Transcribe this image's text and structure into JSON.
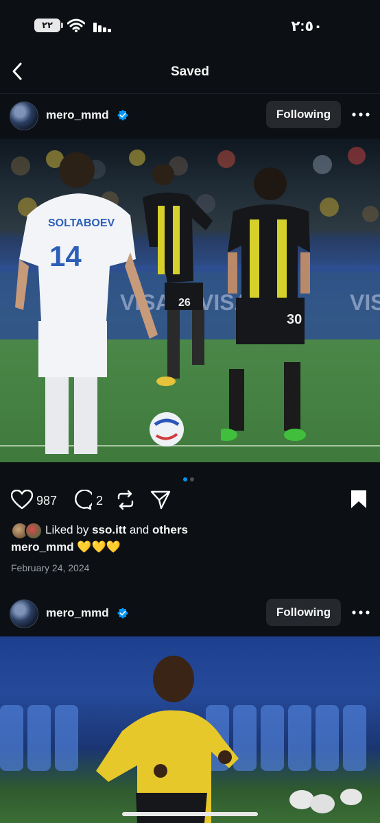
{
  "status_bar": {
    "time": "٢:٥٠",
    "battery": "٢٢"
  },
  "nav": {
    "title": "Saved"
  },
  "posts": [
    {
      "username": "mero_mmd",
      "follow_label": "Following",
      "likes": "987",
      "comments": "2",
      "liked_by_prefix": "Liked by",
      "liked_by_user": "sso.itt",
      "liked_by_and": "and",
      "liked_by_others": "others",
      "caption_user": "mero_mmd",
      "caption_text": "💛💛💛",
      "date": "February 24, 2024",
      "carousel_pages": 2,
      "carousel_active": 1
    },
    {
      "username": "mero_mmd",
      "follow_label": "Following"
    }
  ],
  "colors": {
    "background": "#0c1014",
    "verified": "#0095f6",
    "carousel_active": "#0095f6",
    "button": "#25292e"
  },
  "icons": [
    "back-chevron-icon",
    "verified-badge-icon",
    "more-horizontal-icon",
    "heart-icon",
    "comment-icon",
    "repost-icon",
    "share-icon",
    "bookmark-icon"
  ]
}
